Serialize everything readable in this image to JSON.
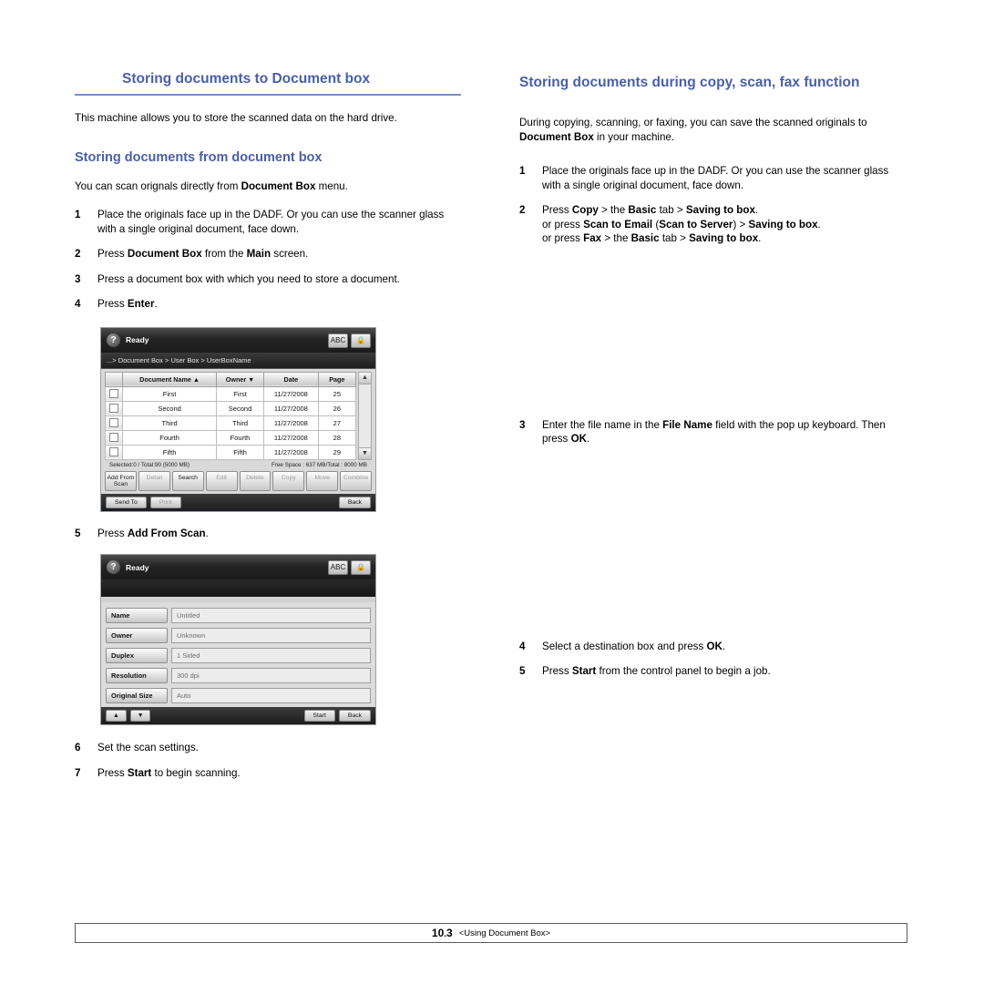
{
  "left": {
    "title": "Storing documents to Document box",
    "intro": "This machine allows you to store the scanned data on the hard drive.",
    "subtitle": "Storing documents from document box",
    "sub_intro_pre": "You can scan orignals directly from ",
    "sub_intro_bold": "Document Box",
    "sub_intro_post": " menu.",
    "steps": [
      {
        "num": "1",
        "text": "Place the originals face up in the DADF. Or you can use the scanner glass with a single original document, face down."
      },
      {
        "num": "2",
        "pre": "Press ",
        "bold1": "Document Box",
        "mid": " from the ",
        "bold2": "Main",
        "post": " screen."
      },
      {
        "num": "3",
        "text": "Press a document box with which you need to store a document."
      },
      {
        "num": "4",
        "pre": "Press ",
        "bold1": "Enter",
        "post": "."
      },
      {
        "num": "5",
        "pre": "Press ",
        "bold1": "Add From Scan",
        "post": "."
      },
      {
        "num": "6",
        "text": "Set the scan settings."
      },
      {
        "num": "7",
        "pre": "Press ",
        "bold1": "Start",
        "post": " to begin scanning."
      }
    ]
  },
  "right": {
    "title": "Storing documents during copy, scan, fax function",
    "intro_pre": "During copying, scanning, or faxing, you can save the scanned originals to ",
    "intro_bold": "Document Box",
    "intro_post": " in your machine.",
    "steps": [
      {
        "num": "1",
        "text": "Place the originals face up in the DADF. Or you can use the scanner glass with a single original document, face down."
      },
      {
        "num": "2",
        "line1_pre": "Press ",
        "line1_b1": "Copy",
        "line1_mid1": " > the ",
        "line1_b2": "Basic",
        "line1_mid2": " tab > ",
        "line1_b3": "Saving to box",
        "line1_post": ".",
        "line2_pre": "or press ",
        "line2_b1": "Scan to Email",
        "line2_mid1": " (",
        "line2_b2": "Scan to Server",
        "line2_mid2": ") > ",
        "line2_b3": "Saving to box",
        "line2_post": ".",
        "line3_pre": "or press ",
        "line3_b1": "Fax",
        "line3_mid1": " > the ",
        "line3_b2": "Basic",
        "line3_mid2": " tab > ",
        "line3_b3": "Saving to box",
        "line3_post": "."
      },
      {
        "num": "3",
        "pre": "Enter the file name in the ",
        "bold1": "File Name",
        "mid": " field with the pop up keyboard. Then press ",
        "bold2": "OK",
        "post": "."
      },
      {
        "num": "4",
        "pre": "Select a destination box and press ",
        "bold1": "OK",
        "post": "."
      },
      {
        "num": "5",
        "pre": "Press ",
        "bold1": "Start",
        "post": " from the control panel to begin a job."
      }
    ]
  },
  "screenshot1": {
    "status": "Ready",
    "help_icon": "?",
    "toolbar_icons": [
      "language-icon",
      "lock-icon"
    ],
    "breadcrumb": "...> Document Box > User Box > UserBoxName",
    "columns": [
      "Document Name",
      "Owner",
      "Date",
      "Page"
    ],
    "sort_arrow": "▲",
    "filter_arrow": "▼",
    "rows": [
      {
        "name": "First",
        "owner": "First",
        "date": "11/27/2008",
        "page": "25"
      },
      {
        "name": "Second",
        "owner": "Second",
        "date": "11/27/2008",
        "page": "26"
      },
      {
        "name": "Third",
        "owner": "Third",
        "date": "11/27/2008",
        "page": "27"
      },
      {
        "name": "Fourth",
        "owner": "Fourth",
        "date": "11/27/2008",
        "page": "28"
      },
      {
        "name": "Fifth",
        "owner": "Fifth",
        "date": "11/27/2008",
        "page": "29"
      }
    ],
    "status_left": "Selected:0  /  Total:90 (5000 MB)",
    "status_right": "Free Space : 637 MB/Total : 8000 MB",
    "toolbar_buttons": [
      "Add From Scan",
      "Detail",
      "Search",
      "Edit",
      "Delete",
      "Copy",
      "Move",
      "Combine"
    ],
    "toolbar_enabled": [
      "Add From Scan",
      "Search"
    ],
    "bottom_left_buttons": [
      "Send To",
      "Print"
    ],
    "bottom_right_button": "Back",
    "scroll_up": "▲",
    "scroll_down": "▼"
  },
  "screenshot2": {
    "status": "Ready",
    "help_icon": "?",
    "toolbar_icons": [
      "language-icon",
      "lock-icon"
    ],
    "fields": [
      {
        "label": "Name",
        "value": "Untitled"
      },
      {
        "label": "Owner",
        "value": "Unknown"
      },
      {
        "label": "Duplex",
        "value": "1 Sided"
      },
      {
        "label": "Resolution",
        "value": "300 dpi"
      },
      {
        "label": "Original Size",
        "value": "Auto"
      }
    ],
    "nav_up": "▲",
    "nav_down": "▼",
    "start_button": "Start",
    "back_button": "Back"
  },
  "footer": {
    "page_number": "10",
    "page_sub": "3",
    "chapter": "<Using Document Box>"
  }
}
